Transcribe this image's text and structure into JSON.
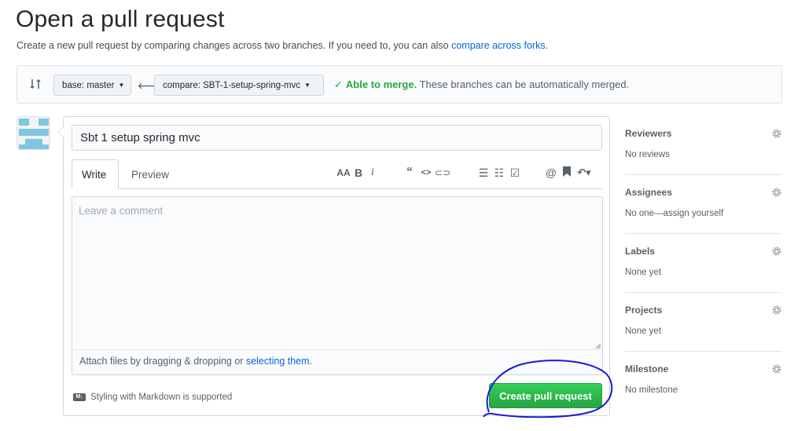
{
  "page": {
    "title": "Open a pull request",
    "subtitle_prefix": "Create a new pull request by comparing changes across two branches. If you need to, you can also ",
    "subtitle_link": "compare across forks",
    "subtitle_suffix": "."
  },
  "compare": {
    "base_label": "base: master",
    "compare_label": "compare: SBT-1-setup-spring-mvc",
    "merge_ok": "Able to merge.",
    "merge_text": " These branches can be automatically merged."
  },
  "form": {
    "title_value": "Sbt 1 setup spring mvc",
    "tabs": [
      {
        "label": "Write",
        "active": true
      },
      {
        "label": "Preview",
        "active": false
      }
    ],
    "toolbar": [
      "header-icon",
      "bold-icon",
      "italic-icon",
      "quote-icon",
      "code-icon",
      "link-icon",
      "bulleted-list-icon",
      "numbered-list-icon",
      "task-list-icon",
      "mention-icon",
      "saved-reply-icon",
      "reply-icon"
    ],
    "comment_placeholder": "Leave a comment",
    "attach_prefix": "Attach files by dragging & dropping or ",
    "attach_link": "selecting them",
    "attach_suffix": ".",
    "markdown_note": "Styling with Markdown is supported",
    "submit_label": "Create pull request"
  },
  "sidebar": [
    {
      "heading": "Reviewers",
      "value": "No reviews"
    },
    {
      "heading": "Assignees",
      "value": "No one—assign yourself"
    },
    {
      "heading": "Labels",
      "value": "None yet"
    },
    {
      "heading": "Projects",
      "value": "None yet"
    },
    {
      "heading": "Milestone",
      "value": "No milestone"
    }
  ],
  "colors": {
    "accent_green": "#28a745",
    "link_blue": "#0366d6",
    "annotation_circle": "#1a1ad4"
  }
}
